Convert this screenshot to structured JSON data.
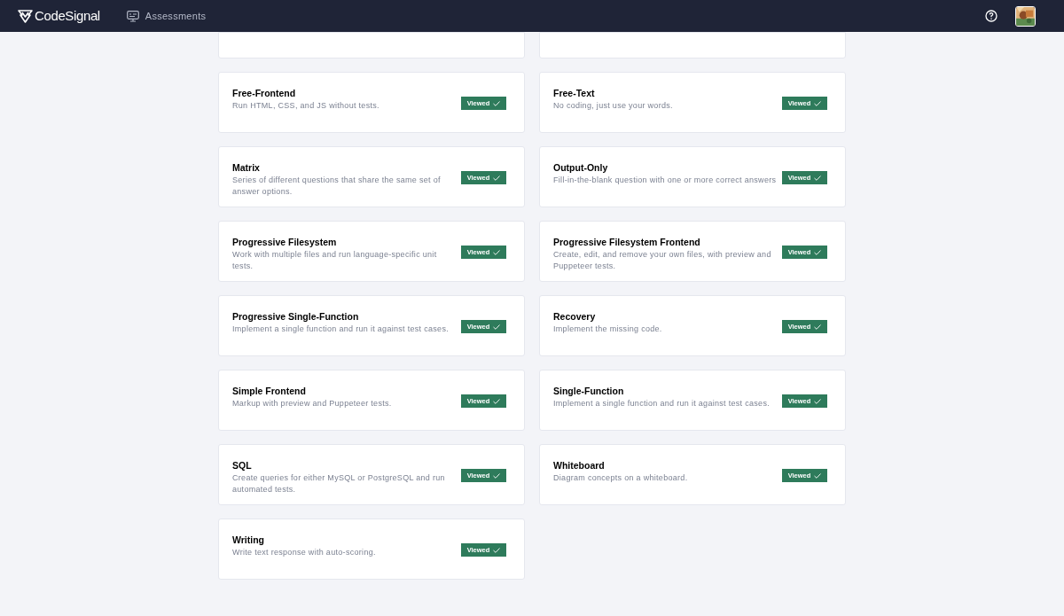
{
  "header": {
    "logo": "CodeSignal",
    "nav": [
      {
        "label": "Assessments",
        "selected": false
      }
    ]
  },
  "cards": [
    {
      "title": "Free-Frontend",
      "description": "Run HTML, CSS, and JS without tests.",
      "status": "Viewed"
    },
    {
      "title": "Free-Text",
      "description": "No coding, just use your words.",
      "status": "Viewed"
    },
    {
      "title": "Matrix",
      "description": "Series of different questions that share the same set of answer options.",
      "status": "Viewed"
    },
    {
      "title": "Output-Only",
      "description": "Fill-in-the-blank question with one or more correct answers",
      "status": "Viewed"
    },
    {
      "title": "Progressive Filesystem",
      "description": "Work with multiple files and run language-specific unit tests.",
      "status": "Viewed"
    },
    {
      "title": "Progressive Filesystem Frontend",
      "description": "Create, edit, and remove your own files, with preview and Puppeteer tests.",
      "status": "Viewed"
    },
    {
      "title": "Progressive Single-Function",
      "description": "Implement a single function and run it against test cases.",
      "status": "Viewed"
    },
    {
      "title": "Recovery",
      "description": "Implement the missing code.",
      "status": "Viewed"
    },
    {
      "title": "Simple Frontend",
      "description": "Markup with preview and Puppeteer tests.",
      "status": "Viewed"
    },
    {
      "title": "Single-Function",
      "description": "Implement a single function and run it against test cases.",
      "status": "Viewed"
    },
    {
      "title": "SQL",
      "description": "Create queries for either MySQL or PostgreSQL and run automated tests.",
      "status": "Viewed"
    },
    {
      "title": "Whiteboard",
      "description": "Diagram concepts on a whiteboard.",
      "status": "Viewed"
    },
    {
      "title": "Writing",
      "description": "Write text response with auto-scoring.",
      "status": "Viewed"
    }
  ]
}
